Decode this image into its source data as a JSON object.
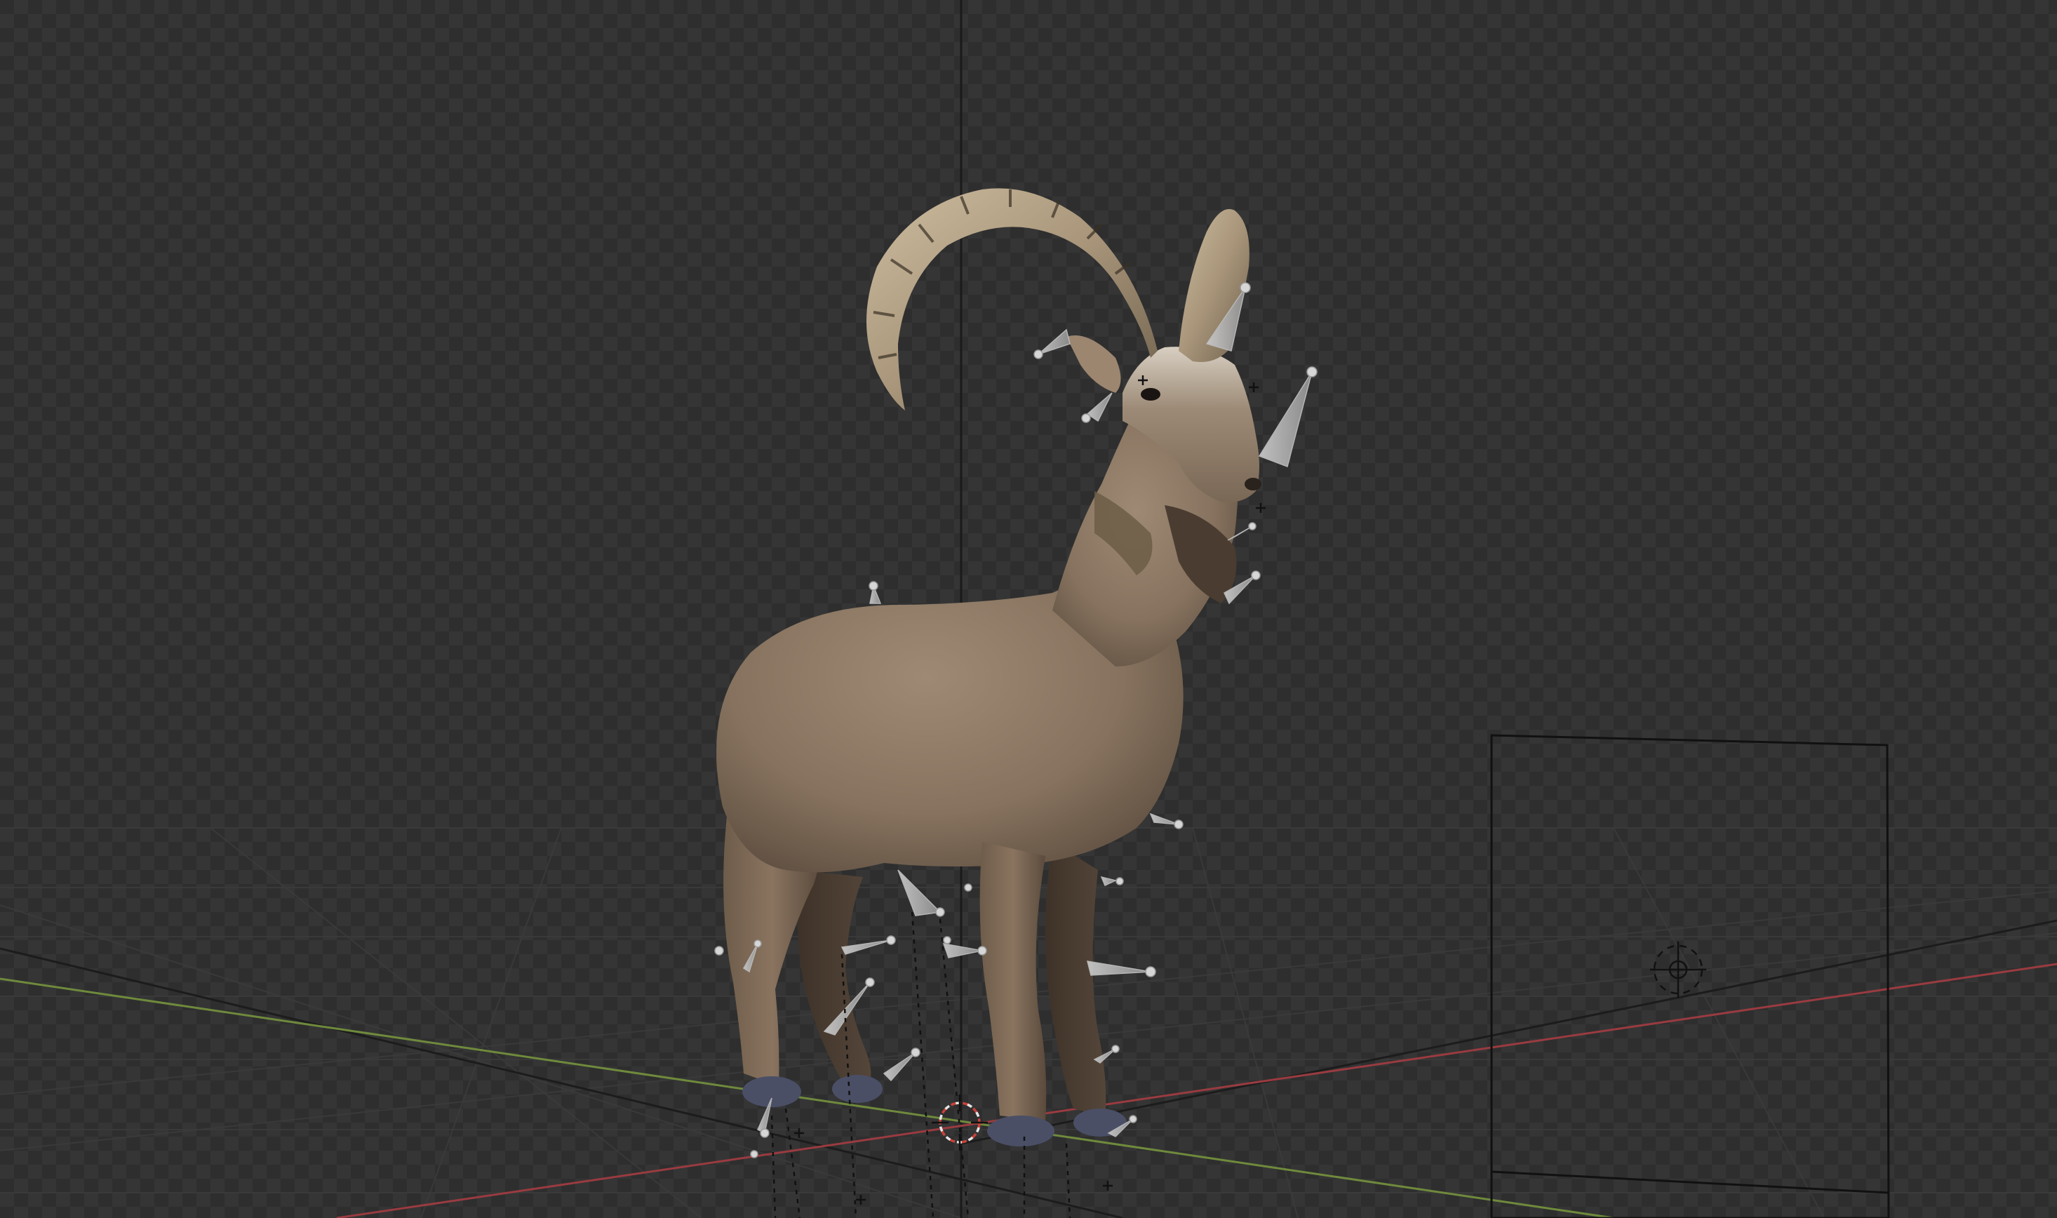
{
  "viewport": {
    "name": "3d-viewport",
    "background": "transparent-checker",
    "checker_color_a": "#2e2e2e",
    "checker_color_b": "#353535"
  },
  "scene": {
    "object": "ibex-model",
    "rig": "armature-bones",
    "camera": "camera-frame",
    "cursor": "3d-cursor",
    "axes": {
      "x_color": "#9a3b40",
      "y_color": "#6f8a3c",
      "z_color": "#1a1a1a"
    },
    "fur_color": "#8a7662",
    "horn_color": "#b8a68a",
    "hoof_color": "#4a4f66"
  }
}
